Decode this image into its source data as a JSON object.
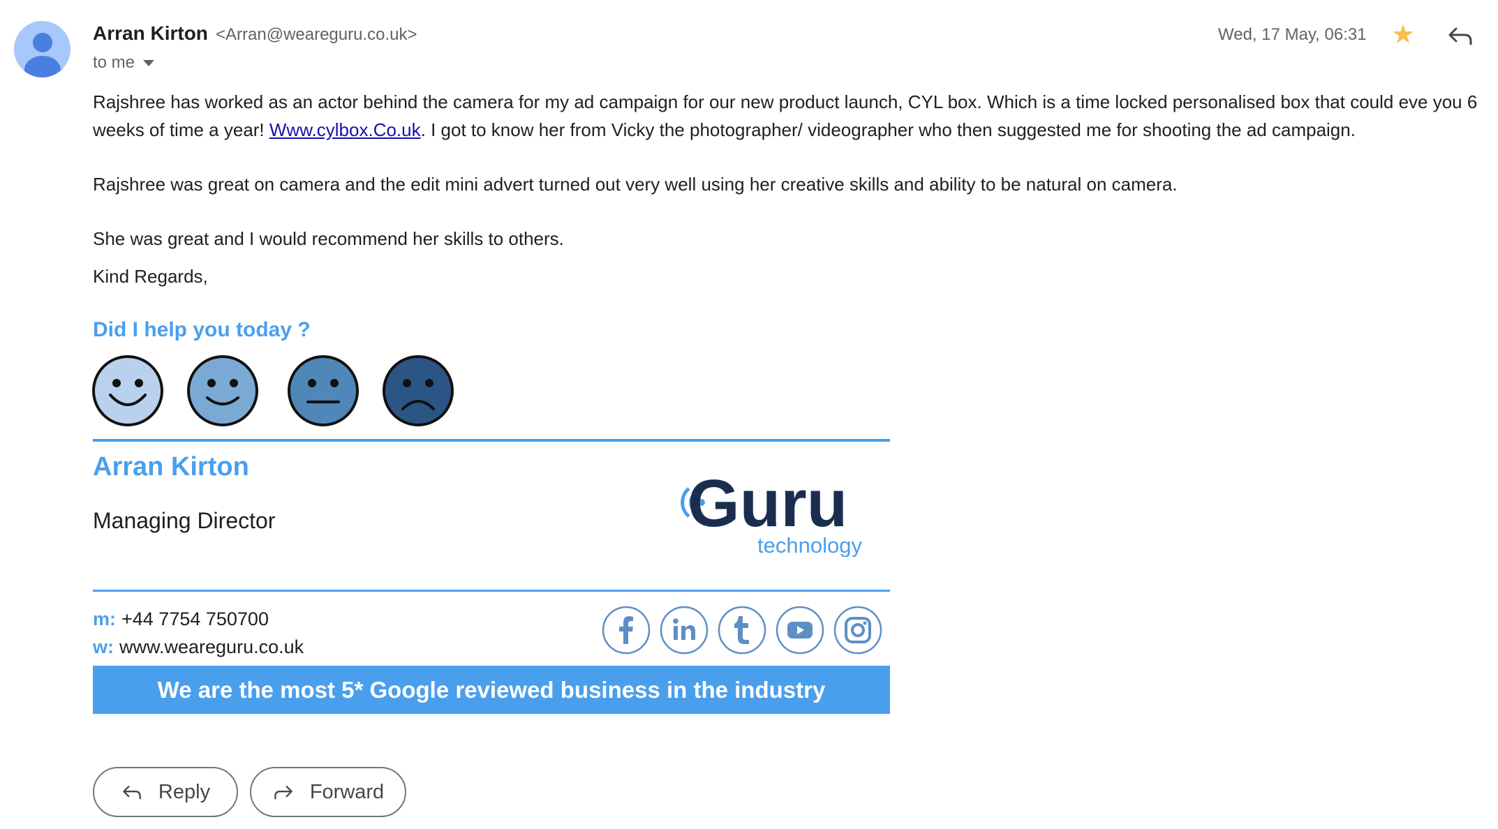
{
  "header": {
    "sender_name": "Arran Kirton",
    "sender_email": "<Arran@weareguru.co.uk>",
    "recipients": "to me",
    "date": "Wed, 17 May, 06:31",
    "star_icon": "star-icon",
    "reply_icon": "reply-arrow-icon"
  },
  "body": {
    "p1_a": "Rajshree has worked as an actor behind the camera for my ad campaign for our new product launch, CYL box. Which is a time locked personalised box that could eve you 6 weeks of time a year! ",
    "p1_link": "Www.cylbox.Co.uk",
    "p1_b": ". I got to know her from Vicky the photographer/ videographer who then suggested me for shooting the ad campaign.",
    "p2": "Rajshree was great on camera and the edit mini advert turned out very well using her creative skills and ability to be natural on camera.",
    "p3": "She was great and I would recommend her skills to others.",
    "p4": "Kind Regards,"
  },
  "signature": {
    "survey_question": "Did I help you today ?",
    "faces": [
      {
        "icon": "very-happy-face-icon",
        "color": "#b9d1ec"
      },
      {
        "icon": "happy-face-icon",
        "color": "#7aaad4"
      },
      {
        "icon": "neutral-face-icon",
        "color": "#4f87b8"
      },
      {
        "icon": "sad-face-icon",
        "color": "#2b5585"
      }
    ],
    "name": "Arran Kirton",
    "title": "Managing Director",
    "logo_text": "Guru",
    "logo_subtext": "technology",
    "phone_label": "m:",
    "phone": "+44 7754 750700",
    "web_label": "w:",
    "web": "www.weareguru.co.uk",
    "social_icons": [
      "facebook-icon",
      "linkedin-icon",
      "tumblr-icon",
      "youtube-icon",
      "instagram-icon"
    ],
    "banner": "We are the most 5* Google reviewed business in the industry",
    "accent_color": "#4a9fec",
    "logo_dark_color": "#1b2d4f"
  },
  "actions": {
    "reply_label": "Reply",
    "forward_label": "Forward"
  }
}
